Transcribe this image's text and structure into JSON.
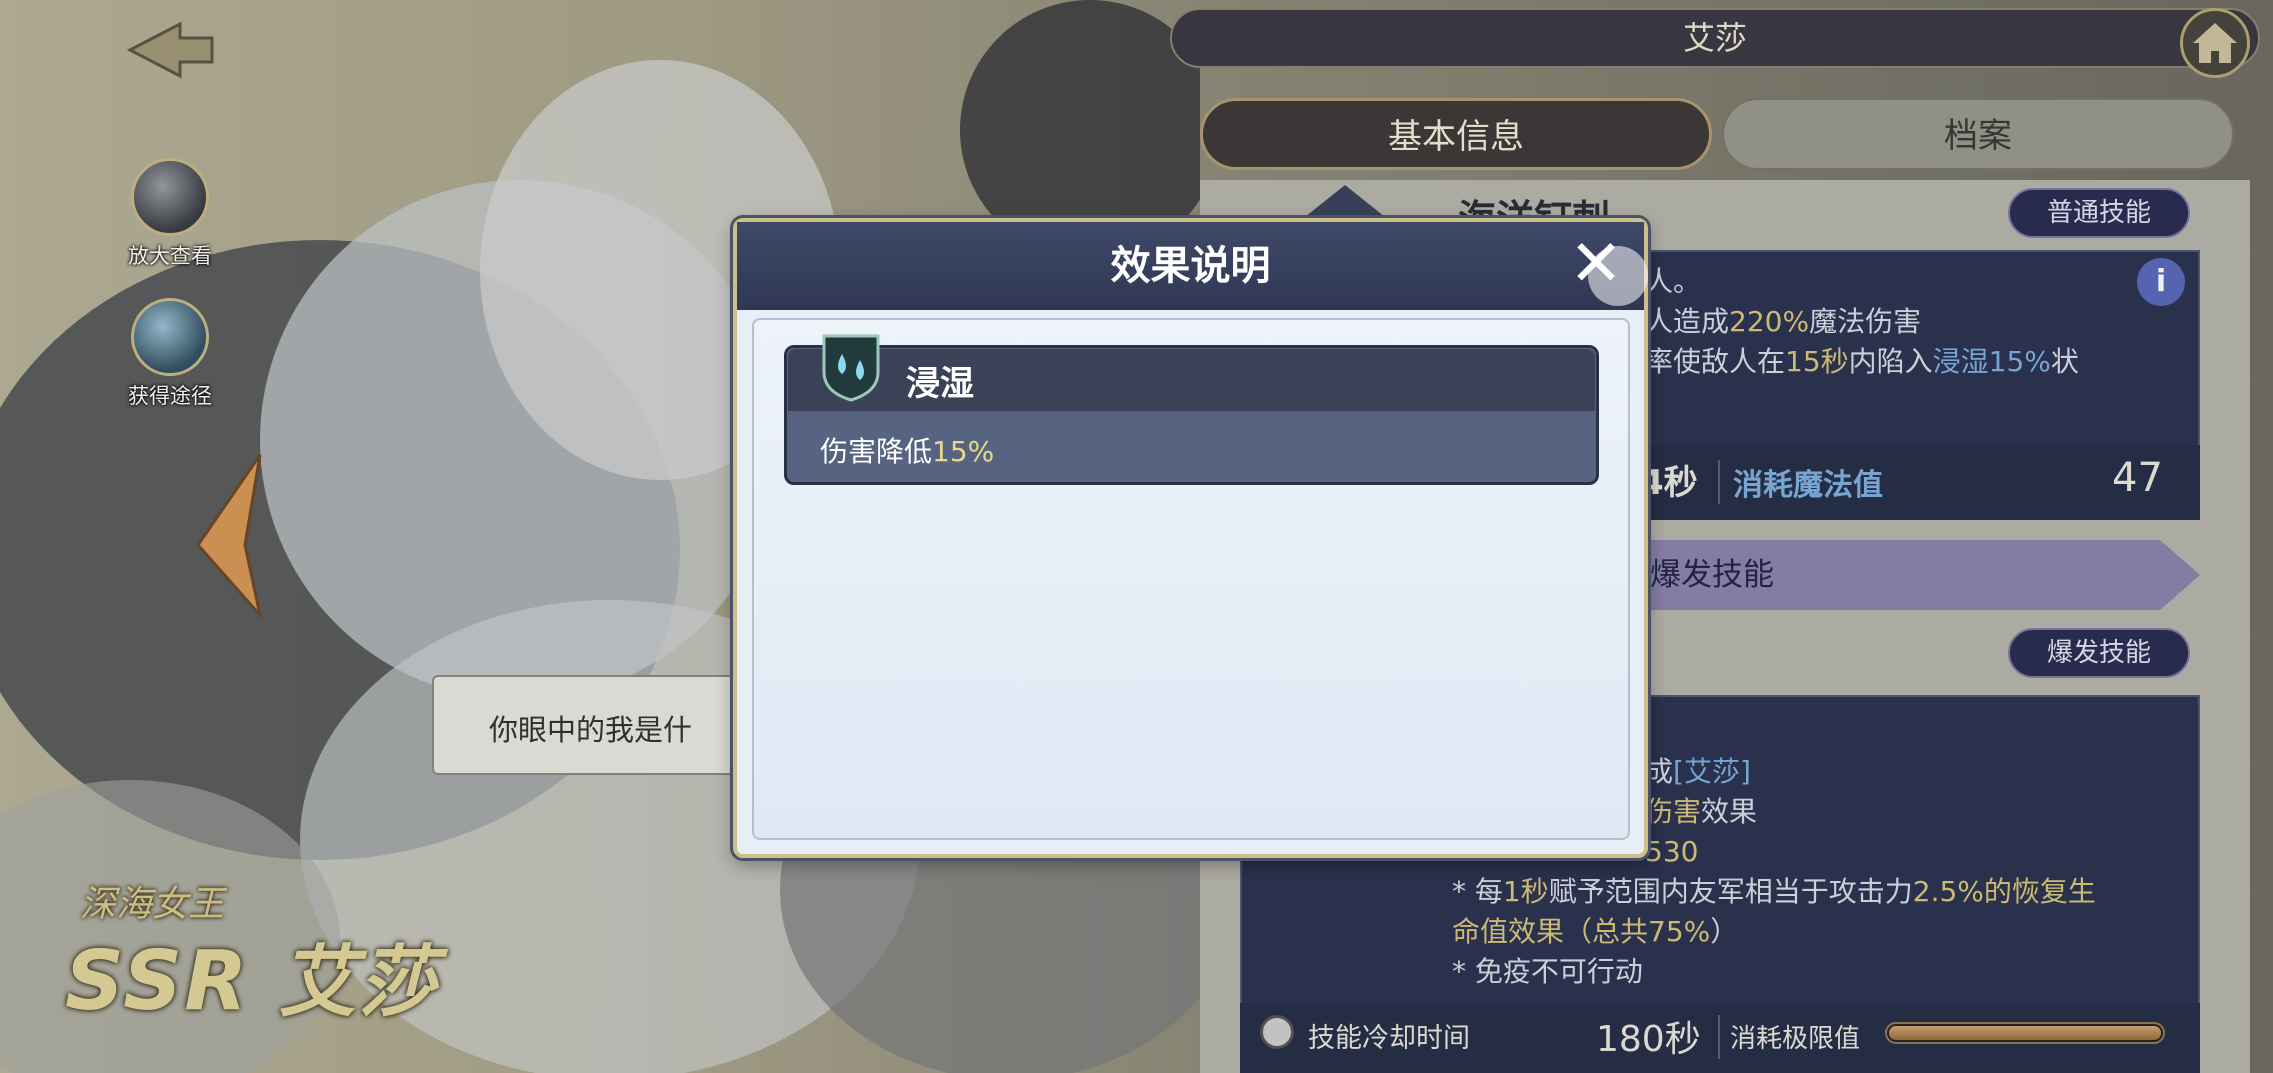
{
  "left_panel": {
    "zoom_label": "放大查看",
    "obtain_label": "获得途径",
    "speech_text": "你眼中的我是什",
    "hero_subtitle": "深海女王",
    "hero_rarity": "SSR",
    "hero_name": "艾莎"
  },
  "header": {
    "title": "艾莎"
  },
  "tabs": [
    {
      "label": "基本信息",
      "active": true
    },
    {
      "label": "档案",
      "active": false
    }
  ],
  "skill1": {
    "name": "海洋钉刺",
    "type_badge": "普通技能",
    "line1": "人。",
    "line2_pre": "人造成",
    "line2_pct": "220%",
    "line2_post": "魔法伤害",
    "line3_pre": "率使敌人在",
    "line3_sec": "15秒",
    "line3_mid": "内陷入",
    "line3_eff": "浸湿15%",
    "line3_post": "状",
    "cooldown_fragment": "4秒",
    "cost_label": "消耗魔法值",
    "cost_value": "47"
  },
  "burst_section_label": "爆发技能",
  "skill2": {
    "type_badge": "爆发技能",
    "line1_pre": "成",
    "line1_name": "[艾莎]",
    "line2_pre": "",
    "line2_hl": "伤害",
    "line2_post": "效果",
    "line3_value": "530",
    "line4_pre": "* 每",
    "line4_sec": "1秒",
    "line4_mid": "赋予范围内友军相当于攻击力",
    "line4_pct": "2.5%",
    "line4_post": "的恢复生",
    "line5_pre": "命值效果（总共",
    "line5_pct": "75%",
    "line5_post": "）",
    "line6": "* 免疫不可行动",
    "cooldown_label": "技能冷却时间",
    "cooldown_value": "180秒",
    "cost_label": "消耗极限值",
    "cost_fill": 1.0
  },
  "modal": {
    "title": "效果说明",
    "effect_name": "浸湿",
    "effect_desc_pre": "伤害降低",
    "effect_desc_pct": "15%"
  },
  "colors": {
    "panel_dark": "#2c3552",
    "highlight_gold": "#d9c57a",
    "highlight_blue": "#7fb0e0",
    "modal_header": "#3f4968"
  }
}
